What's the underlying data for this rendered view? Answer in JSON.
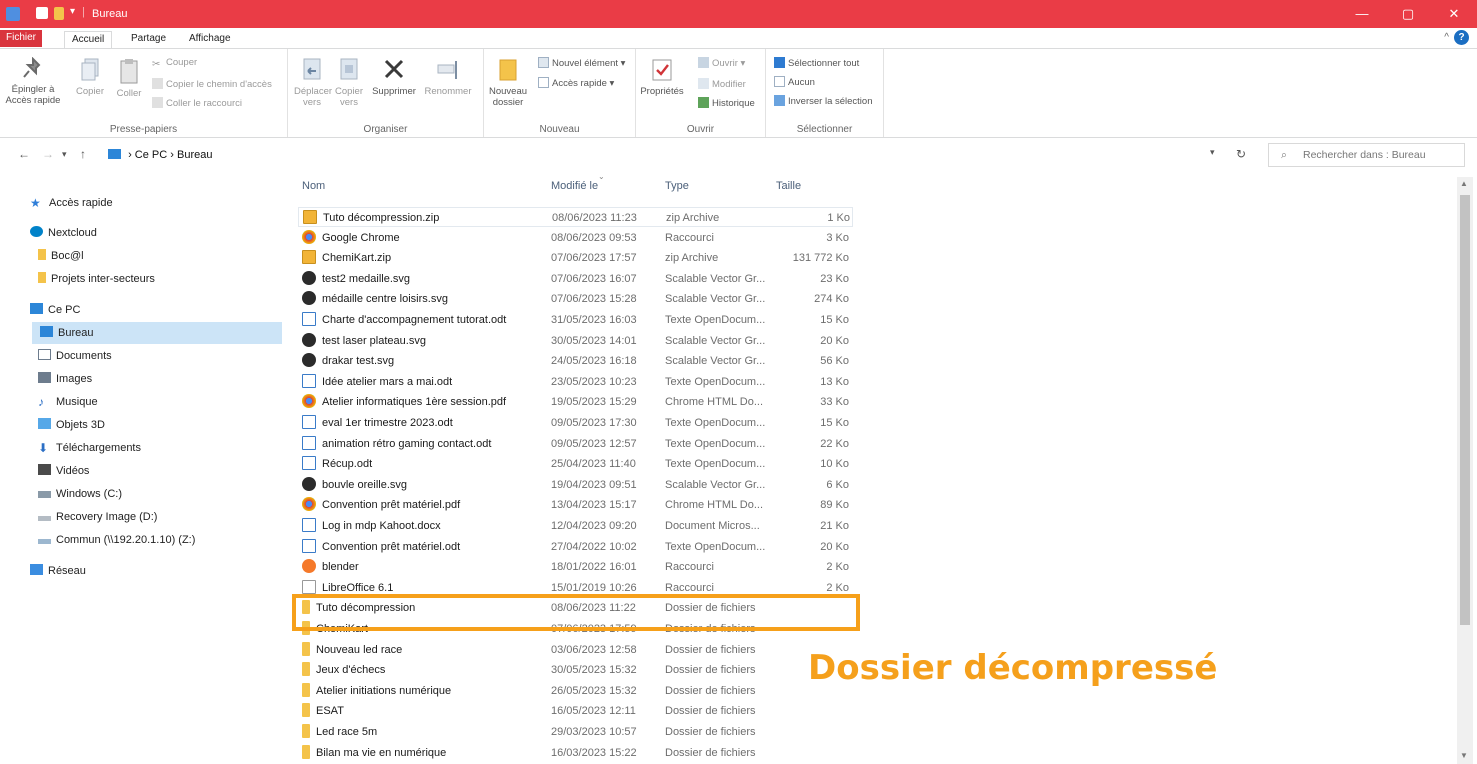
{
  "window": {
    "title": "Bureau",
    "colors": {
      "titlebar": "#ea3c46",
      "accent": "#f6a01a"
    }
  },
  "tabs": {
    "file": "Fichier",
    "home": "Accueil",
    "share": "Partage",
    "view": "Affichage",
    "help": "?"
  },
  "ribbon": {
    "clipboard": {
      "label": "Presse-papiers",
      "pin": "Épingler à Accès rapide",
      "copy": "Copier",
      "paste": "Coller",
      "cut": "Couper",
      "copy_path": "Copier le chemin d'accès",
      "paste_shortcut": "Coller le raccourci"
    },
    "organize": {
      "label": "Organiser",
      "move_to": "Déplacer vers",
      "copy_to": "Copier vers",
      "delete": "Supprimer",
      "rename": "Renommer"
    },
    "new": {
      "label": "Nouveau",
      "new_folder": "Nouveau dossier",
      "new_item": "Nouvel élément",
      "quick_access": "Accès rapide"
    },
    "open": {
      "label": "Ouvrir",
      "properties": "Propriétés",
      "open": "Ouvrir",
      "edit": "Modifier",
      "history": "Historique"
    },
    "select": {
      "label": "Sélectionner",
      "select_all": "Sélectionner tout",
      "none": "Aucun",
      "invert": "Inverser la sélection"
    }
  },
  "address": {
    "path_root": "Ce PC",
    "path_current": "Bureau",
    "search_placeholder": "Rechercher dans : Bureau"
  },
  "sidebar": {
    "items": [
      {
        "label": "Accès rapide",
        "icon": "star-icon"
      },
      {
        "label": "Nextcloud",
        "icon": "cloud-icon"
      },
      {
        "label": "Boc@l",
        "icon": "folder-icon"
      },
      {
        "label": "Projets inter-secteurs",
        "icon": "folder-icon"
      },
      {
        "label": "Ce PC",
        "icon": "pc-icon"
      },
      {
        "label": "Bureau",
        "icon": "desktop-icon"
      },
      {
        "label": "Documents",
        "icon": "documents-icon"
      },
      {
        "label": "Images",
        "icon": "images-icon"
      },
      {
        "label": "Musique",
        "icon": "music-icon"
      },
      {
        "label": "Objets 3D",
        "icon": "objects3d-icon"
      },
      {
        "label": "Téléchargements",
        "icon": "download-icon"
      },
      {
        "label": "Vidéos",
        "icon": "video-icon"
      },
      {
        "label": "Windows (C:)",
        "icon": "drive-icon"
      },
      {
        "label": "Recovery Image (D:)",
        "icon": "drive-icon"
      },
      {
        "label": "Commun (\\\\192.20.1.10) (Z:)",
        "icon": "network-drive-icon"
      },
      {
        "label": "Réseau",
        "icon": "network-icon"
      }
    ]
  },
  "columns": {
    "name": "Nom",
    "modified": "Modifié le",
    "type": "Type",
    "size": "Taille"
  },
  "files": [
    {
      "name": "Tuto décompression.zip",
      "date": "08/06/2023 11:23",
      "type": "zip Archive",
      "size": "1 Ko",
      "icon": "zip-icon"
    },
    {
      "name": "Google Chrome",
      "date": "08/06/2023 09:53",
      "type": "Raccourci",
      "size": "3 Ko",
      "icon": "chrome-icon"
    },
    {
      "name": "ChemiKart.zip",
      "date": "07/06/2023 17:57",
      "type": "zip Archive",
      "size": "131 772 Ko",
      "icon": "zip-icon"
    },
    {
      "name": "test2 medaille.svg",
      "date": "07/06/2023 16:07",
      "type": "Scalable Vector Gr...",
      "size": "23 Ko",
      "icon": "svg-icon"
    },
    {
      "name": "médaille centre loisirs.svg",
      "date": "07/06/2023 15:28",
      "type": "Scalable Vector Gr...",
      "size": "274 Ko",
      "icon": "svg-icon"
    },
    {
      "name": "Charte d'accompagnement tutorat.odt",
      "date": "31/05/2023 16:03",
      "type": "Texte OpenDocum...",
      "size": "15 Ko",
      "icon": "odt-icon"
    },
    {
      "name": "test laser plateau.svg",
      "date": "30/05/2023 14:01",
      "type": "Scalable Vector Gr...",
      "size": "20 Ko",
      "icon": "svg-icon"
    },
    {
      "name": "drakar test.svg",
      "date": "24/05/2023 16:18",
      "type": "Scalable Vector Gr...",
      "size": "56 Ko",
      "icon": "svg-icon"
    },
    {
      "name": "Idée atelier mars a mai.odt",
      "date": "23/05/2023 10:23",
      "type": "Texte OpenDocum...",
      "size": "13 Ko",
      "icon": "odt-icon"
    },
    {
      "name": "Atelier informatiques 1ère session.pdf",
      "date": "19/05/2023 15:29",
      "type": "Chrome HTML Do...",
      "size": "33 Ko",
      "icon": "chrome-icon"
    },
    {
      "name": "eval 1er trimestre 2023.odt",
      "date": "09/05/2023 17:30",
      "type": "Texte OpenDocum...",
      "size": "15 Ko",
      "icon": "odt-icon"
    },
    {
      "name": "animation rétro gaming contact.odt",
      "date": "09/05/2023 12:57",
      "type": "Texte OpenDocum...",
      "size": "22 Ko",
      "icon": "odt-icon"
    },
    {
      "name": "Récup.odt",
      "date": "25/04/2023 11:40",
      "type": "Texte OpenDocum...",
      "size": "10 Ko",
      "icon": "odt-icon"
    },
    {
      "name": "bouvle oreille.svg",
      "date": "19/04/2023 09:51",
      "type": "Scalable Vector Gr...",
      "size": "6 Ko",
      "icon": "svg-icon"
    },
    {
      "name": "Convention prêt matériel.pdf",
      "date": "13/04/2023 15:17",
      "type": "Chrome HTML Do...",
      "size": "89 Ko",
      "icon": "chrome-icon"
    },
    {
      "name": "Log in mdp Kahoot.docx",
      "date": "12/04/2023 09:20",
      "type": "Document Micros...",
      "size": "21 Ko",
      "icon": "docx-icon"
    },
    {
      "name": "Convention prêt matériel.odt",
      "date": "27/04/2022 10:02",
      "type": "Texte OpenDocum...",
      "size": "20 Ko",
      "icon": "odt-icon"
    },
    {
      "name": "blender",
      "date": "18/01/2022 16:01",
      "type": "Raccourci",
      "size": "2 Ko",
      "icon": "blender-icon"
    },
    {
      "name": "LibreOffice 6.1",
      "date": "15/01/2019 10:26",
      "type": "Raccourci",
      "size": "2 Ko",
      "icon": "shortcut-icon"
    },
    {
      "name": "Tuto décompression",
      "date": "08/06/2023 11:22",
      "type": "Dossier de fichiers",
      "size": "",
      "icon": "folder-icon"
    },
    {
      "name": "ChemiKart",
      "date": "07/06/2023 17:59",
      "type": "Dossier de fichiers",
      "size": "",
      "icon": "folder-icon"
    },
    {
      "name": "Nouveau led race",
      "date": "03/06/2023 12:58",
      "type": "Dossier de fichiers",
      "size": "",
      "icon": "folder-icon"
    },
    {
      "name": "Jeux d'échecs",
      "date": "30/05/2023 15:32",
      "type": "Dossier de fichiers",
      "size": "",
      "icon": "folder-icon"
    },
    {
      "name": "Atelier initiations numérique",
      "date": "26/05/2023 15:32",
      "type": "Dossier de fichiers",
      "size": "",
      "icon": "folder-icon"
    },
    {
      "name": "ESAT",
      "date": "16/05/2023 12:11",
      "type": "Dossier de fichiers",
      "size": "",
      "icon": "folder-icon"
    },
    {
      "name": "Led race 5m",
      "date": "29/03/2023 10:57",
      "type": "Dossier de fichiers",
      "size": "",
      "icon": "folder-icon"
    },
    {
      "name": "Bilan ma vie en numérique",
      "date": "16/03/2023 15:22",
      "type": "Dossier de fichiers",
      "size": "",
      "icon": "folder-icon"
    }
  ],
  "annotation": {
    "text": "Dossier décompressé"
  }
}
